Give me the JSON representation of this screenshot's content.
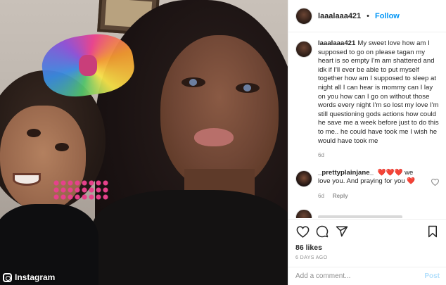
{
  "post": {
    "username": "laaalaaa421",
    "follow_separator": "•",
    "follow_label": "Follow",
    "caption_username": "laaalaaa421",
    "caption_text": "My sweet love how am I supposed to go on please tagan my heart is so empty I'm am shattered and idk if I'll ever be able to put myself together how am I supposed to sleep at night all I can hear is mommy can I lay on you how can I go on without those words every night I'm so lost my love I'm still questioning gods actions how could he save me a week before just to do this to me.. he could have took me I wish he would have took me",
    "caption_time": "6d"
  },
  "comments": [
    {
      "username": "_prettyplainjane_",
      "text_hearts": "❤️❤️❤️",
      "text": "we love you. And praying for you",
      "text_tail_heart": "❤️",
      "time": "6d",
      "reply_label": "Reply"
    }
  ],
  "footer": {
    "likes": "86 likes",
    "date": "6 DAYS AGO",
    "comment_placeholder": "Add a comment...",
    "post_label": "Post"
  },
  "watermark": {
    "label": "Instagram"
  },
  "icons": {
    "like": "heart-icon",
    "comment": "comment-icon",
    "share": "share-icon",
    "save": "bookmark-icon",
    "comment_like": "heart-icon"
  },
  "colors": {
    "accent": "#0095f6",
    "post_disabled": "#b2dffc",
    "secondary_text": "#8e8e8e",
    "border": "#efefef"
  }
}
